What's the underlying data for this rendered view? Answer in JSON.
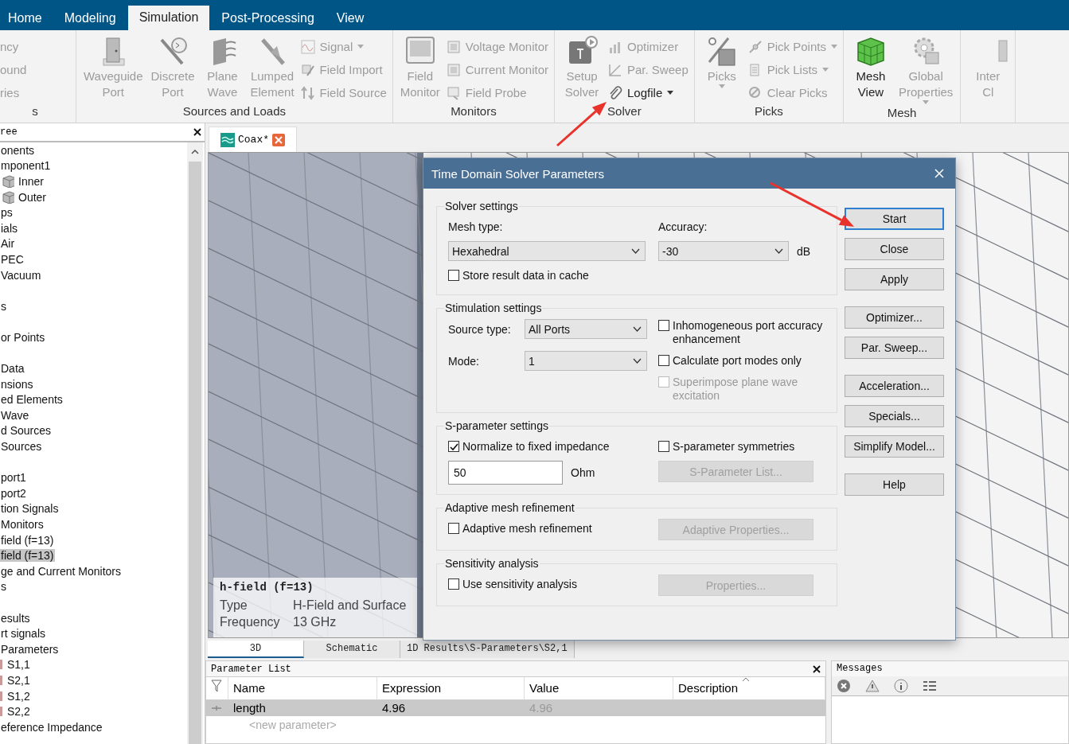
{
  "ribbon": {
    "tabs": [
      {
        "label": "Home",
        "selected": false
      },
      {
        "label": "Modeling",
        "selected": false
      },
      {
        "label": "Simulation",
        "selected": true
      },
      {
        "label": "Post-Processing",
        "selected": false
      },
      {
        "label": "View",
        "selected": false
      }
    ],
    "groups": [
      {
        "label": "s",
        "small": [
          {
            "label": "ncy",
            "disabled": true,
            "dropdown": false
          },
          {
            "label": "ound",
            "disabled": true,
            "dropdown": false
          },
          {
            "label": "ries",
            "disabled": true,
            "dropdown": false
          }
        ]
      },
      {
        "label": "Sources and Loads",
        "large": [
          {
            "label": "Waveguide Port",
            "disabled": true,
            "dropdown": false
          },
          {
            "label": "Discrete Port",
            "disabled": true,
            "dropdown": false
          },
          {
            "label": "Plane Wave",
            "disabled": true,
            "dropdown": false
          },
          {
            "label": "Lumped Element",
            "disabled": true,
            "dropdown": false
          }
        ],
        "small": [
          {
            "label": "Signal",
            "disabled": true,
            "dropdown": true
          },
          {
            "label": "Field Import",
            "disabled": true,
            "dropdown": false
          },
          {
            "label": "Field Source",
            "disabled": true,
            "dropdown": false
          }
        ]
      },
      {
        "label": "Monitors",
        "large": [
          {
            "label": "Field Monitor",
            "disabled": true,
            "dropdown": false
          }
        ],
        "small": [
          {
            "label": "Voltage Monitor",
            "disabled": true,
            "dropdown": false
          },
          {
            "label": "Current Monitor",
            "disabled": true,
            "dropdown": false
          },
          {
            "label": "Field Probe",
            "disabled": true,
            "dropdown": false
          }
        ]
      },
      {
        "label": "Solver",
        "large": [
          {
            "label": "Setup Solver",
            "disabled": true,
            "dropdown": false
          }
        ],
        "small": [
          {
            "label": "Optimizer",
            "disabled": true,
            "dropdown": false
          },
          {
            "label": "Par. Sweep",
            "disabled": true,
            "dropdown": false
          },
          {
            "label": "Logfile",
            "disabled": false,
            "dropdown": true
          }
        ]
      },
      {
        "label": "Picks",
        "large": [
          {
            "label": "Picks",
            "disabled": true,
            "dropdown": true
          }
        ],
        "small": [
          {
            "label": "Pick Points",
            "disabled": true,
            "dropdown": true
          },
          {
            "label": "Pick Lists",
            "disabled": true,
            "dropdown": true
          },
          {
            "label": "Clear Picks",
            "disabled": true,
            "dropdown": false
          }
        ]
      },
      {
        "label": "Mesh",
        "large": [
          {
            "label": "Mesh View",
            "disabled": false,
            "dropdown": false
          },
          {
            "label": "Global Properties",
            "disabled": true,
            "dropdown": true
          }
        ]
      },
      {
        "large": [
          {
            "label": "Inter Cl",
            "disabled": true,
            "dropdown": false
          }
        ]
      }
    ]
  },
  "tree": {
    "title": "ree",
    "items": [
      {
        "label": "onents",
        "kind": "node",
        "selected": false,
        "children": [
          {
            "label": "mponent1",
            "kind": "node",
            "selected": false,
            "children": [
              {
                "label": "Inner",
                "kind": "solid",
                "selected": false
              },
              {
                "label": "Outer",
                "kind": "solid",
                "selected": false
              }
            ]
          }
        ]
      },
      {
        "label": "ps",
        "kind": "node",
        "selected": false
      },
      {
        "label": "ials",
        "kind": "node",
        "selected": false,
        "children": [
          {
            "label": "Air",
            "kind": "node",
            "selected": false
          },
          {
            "label": "PEC",
            "kind": "node",
            "selected": false
          },
          {
            "label": "Vacuum",
            "kind": "node",
            "selected": false
          }
        ]
      },
      {
        "kind": "blank"
      },
      {
        "label": "s",
        "kind": "node",
        "selected": false
      },
      {
        "kind": "blank"
      },
      {
        "label": "or Points",
        "kind": "node",
        "selected": false
      },
      {
        "kind": "blank"
      },
      {
        "label": "Data",
        "kind": "node",
        "selected": false
      },
      {
        "label": "nsions",
        "kind": "node",
        "selected": false
      },
      {
        "label": "ed Elements",
        "kind": "node",
        "selected": false
      },
      {
        "label": "Wave",
        "kind": "node",
        "selected": false
      },
      {
        "label": "d Sources",
        "kind": "node",
        "selected": false
      },
      {
        "label": "Sources",
        "kind": "node",
        "selected": false
      },
      {
        "kind": "blank"
      },
      {
        "label": "port1",
        "kind": "node",
        "selected": false
      },
      {
        "label": "port2",
        "kind": "node",
        "selected": false
      },
      {
        "label": "tion Signals",
        "kind": "node",
        "selected": false
      },
      {
        "label": "Monitors",
        "kind": "node",
        "selected": false
      },
      {
        "label": "field (f=13)",
        "kind": "node",
        "selected": false
      },
      {
        "label": "field (f=13)",
        "kind": "node",
        "selected": true
      },
      {
        "label": "ge and Current Monitors",
        "kind": "node",
        "selected": false
      },
      {
        "label": "s",
        "kind": "node",
        "selected": false
      },
      {
        "kind": "blank"
      },
      {
        "label": "esults",
        "kind": "node",
        "selected": false
      },
      {
        "label": "rt signals",
        "kind": "node",
        "selected": false
      },
      {
        "label": "Parameters",
        "kind": "node",
        "selected": false,
        "children": [
          {
            "label": "S1,1",
            "kind": "result",
            "selected": false
          },
          {
            "label": "S2,1",
            "kind": "result",
            "selected": false
          },
          {
            "label": "S1,2",
            "kind": "result",
            "selected": false
          },
          {
            "label": "S2,2",
            "kind": "result",
            "selected": false
          }
        ]
      },
      {
        "label": "eference Impedance",
        "kind": "node",
        "selected": false
      }
    ]
  },
  "document": {
    "tab": "Coax*",
    "view": {
      "title": "h-field (f=13)",
      "properties": [
        {
          "name": "Type",
          "value": "H-Field and Surface"
        },
        {
          "name": "Frequency",
          "value": "13 GHz"
        }
      ],
      "tabs": [
        {
          "label": "3D",
          "selected": true
        },
        {
          "label": "Schematic",
          "selected": false
        },
        {
          "label": "1D Results\\S-Parameters\\S2,1",
          "selected": false
        }
      ]
    }
  },
  "parameter_list": {
    "title": "Parameter List",
    "columns": [
      "Name",
      "Expression",
      "Value",
      "Description"
    ],
    "rows": [
      {
        "name": "length",
        "expression": "4.96",
        "value": "4.96",
        "selected": true
      }
    ],
    "new_row": "<new parameter>"
  },
  "messages": {
    "title": "Messages"
  },
  "dialog": {
    "title": "Time Domain Solver Parameters",
    "groups": [
      {
        "title": "Solver settings",
        "rows": [
          {
            "left": [
              {
                "kind": "label",
                "text": "Mesh type:"
              }
            ],
            "right": [
              {
                "kind": "label",
                "text": "Accuracy:"
              }
            ]
          },
          {
            "left": [
              {
                "kind": "select",
                "value": "Hexahedral"
              }
            ],
            "right": [
              {
                "kind": "select",
                "value": "-30"
              },
              {
                "kind": "label",
                "text": "dB"
              }
            ]
          },
          {
            "left": [
              {
                "kind": "checkbox",
                "label": "Store result data in cache",
                "checked": false,
                "disabled": false
              }
            ]
          }
        ]
      },
      {
        "title": "Stimulation settings",
        "rows": [
          {
            "left": [
              {
                "kind": "label",
                "text": "Source type:"
              },
              {
                "kind": "select",
                "value": "All Ports"
              }
            ],
            "right": [
              {
                "kind": "checkbox",
                "label": "Inhomogeneous port accuracy enhancement",
                "checked": false,
                "disabled": false
              }
            ]
          },
          {
            "left": [
              {
                "kind": "label",
                "text": "Mode:"
              },
              {
                "kind": "select",
                "value": "1"
              }
            ],
            "right": [
              {
                "kind": "checkbox",
                "label": "Calculate port modes only",
                "checked": false,
                "disabled": false
              }
            ]
          },
          {
            "right": [
              {
                "kind": "checkbox",
                "label": "Superimpose plane wave excitation",
                "checked": false,
                "disabled": true
              }
            ]
          }
        ]
      },
      {
        "title": "S-parameter settings",
        "rows": [
          {
            "left": [
              {
                "kind": "checkbox",
                "label": "Normalize to fixed impedance",
                "checked": true,
                "disabled": false
              }
            ],
            "right": [
              {
                "kind": "checkbox",
                "label": "S-parameter symmetries",
                "checked": false,
                "disabled": false
              }
            ]
          },
          {
            "left": [
              {
                "kind": "input",
                "value": "50"
              },
              {
                "kind": "label",
                "text": "Ohm"
              }
            ],
            "right": [
              {
                "kind": "button",
                "label": "S-Parameter List...",
                "disabled": true
              }
            ]
          }
        ]
      },
      {
        "title": "Adaptive mesh refinement",
        "rows": [
          {
            "left": [
              {
                "kind": "checkbox",
                "label": "Adaptive mesh refinement",
                "checked": false,
                "disabled": false
              }
            ],
            "right": [
              {
                "kind": "button",
                "label": "Adaptive Properties...",
                "disabled": true
              }
            ]
          }
        ]
      },
      {
        "title": "Sensitivity analysis",
        "rows": [
          {
            "left": [
              {
                "kind": "checkbox",
                "label": "Use sensitivity analysis",
                "checked": false,
                "disabled": false
              }
            ],
            "right": [
              {
                "kind": "button",
                "label": "Properties...",
                "disabled": true
              }
            ]
          }
        ]
      }
    ],
    "button_groups": [
      [
        {
          "label": "Start",
          "default": true
        },
        {
          "label": "Close",
          "default": false
        },
        {
          "label": "Apply",
          "default": false
        }
      ],
      [
        {
          "label": "Optimizer...",
          "default": false
        },
        {
          "label": "Par. Sweep...",
          "default": false
        }
      ],
      [
        {
          "label": "Acceleration...",
          "default": false
        },
        {
          "label": "Specials...",
          "default": false
        },
        {
          "label": "Simplify Model...",
          "default": false
        }
      ],
      [
        {
          "label": "Help",
          "default": false
        }
      ]
    ]
  },
  "annotation_arrows": [
    {
      "kind": "arrow"
    },
    {
      "kind": "arrow"
    }
  ]
}
